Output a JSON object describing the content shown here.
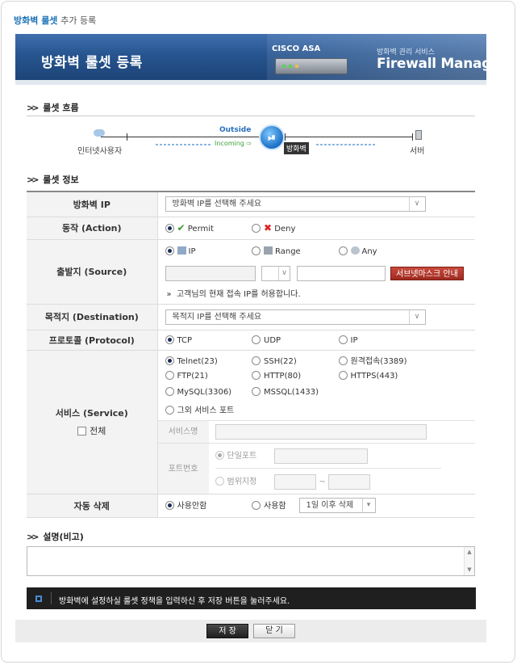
{
  "breadcrumb": {
    "highlight": "방화벽 룰셋",
    "rest": "추가 등록"
  },
  "banner": {
    "title": "방화벽 룰셋 등록",
    "device_label": "CISCO ASA",
    "service_small": "방화벽 관리 서비스",
    "service_title": "Firewall Manager"
  },
  "flow": {
    "section_title": "룰셋 흐름",
    "left_label": "인터넷사용자",
    "outside_label": "Outside",
    "incoming_label": "Incoming ⇨",
    "firewall_tag": "방화벽",
    "right_label": "서버"
  },
  "info": {
    "section_title": "룰셋 정보",
    "firewall_ip": {
      "label": "방화벽 IP",
      "placeholder": "방화벽 IP를 선택해 주세요"
    },
    "action": {
      "label": "동작 (Action)",
      "permit": "Permit",
      "deny": "Deny"
    },
    "source": {
      "label": "출발지 (Source)",
      "ip": "IP",
      "range": "Range",
      "any": "Any",
      "subnet_button": "서브넷마스크 안내",
      "hint": "고객님의 현재 접속 IP를 허용합니다."
    },
    "destination": {
      "label": "목적지 (Destination)",
      "placeholder": "목적지 IP를 선택해 주세요"
    },
    "protocol": {
      "label": "프로토콜 (Protocol)",
      "tcp": "TCP",
      "udp": "UDP",
      "ip": "IP"
    },
    "service": {
      "label": "서비스 (Service)",
      "all_label": "전체",
      "options": [
        "Telnet(23)",
        "SSH(22)",
        "원격접속(3389)",
        "FTP(21)",
        "HTTP(80)",
        "HTTPS(443)",
        "MySQL(3306)",
        "MSSQL(1433)"
      ],
      "other_port": "그외 서비스 포트",
      "service_name_label": "서비스명",
      "port_label": "포트번호",
      "single_port": "단일포트",
      "range_port": "범위지정",
      "tilde": "~"
    },
    "auto_delete": {
      "label": "자동 삭제",
      "not_use": "사용안함",
      "use": "사용함",
      "period": "1일 이후 삭제"
    }
  },
  "description": {
    "section_title": "설명(비고)"
  },
  "notice": "방화벽에 설정하실 룰셋 정책을 입력하신 후 저장 버튼을 눌러주세요.",
  "buttons": {
    "save": "저 장",
    "close": "닫 기"
  }
}
